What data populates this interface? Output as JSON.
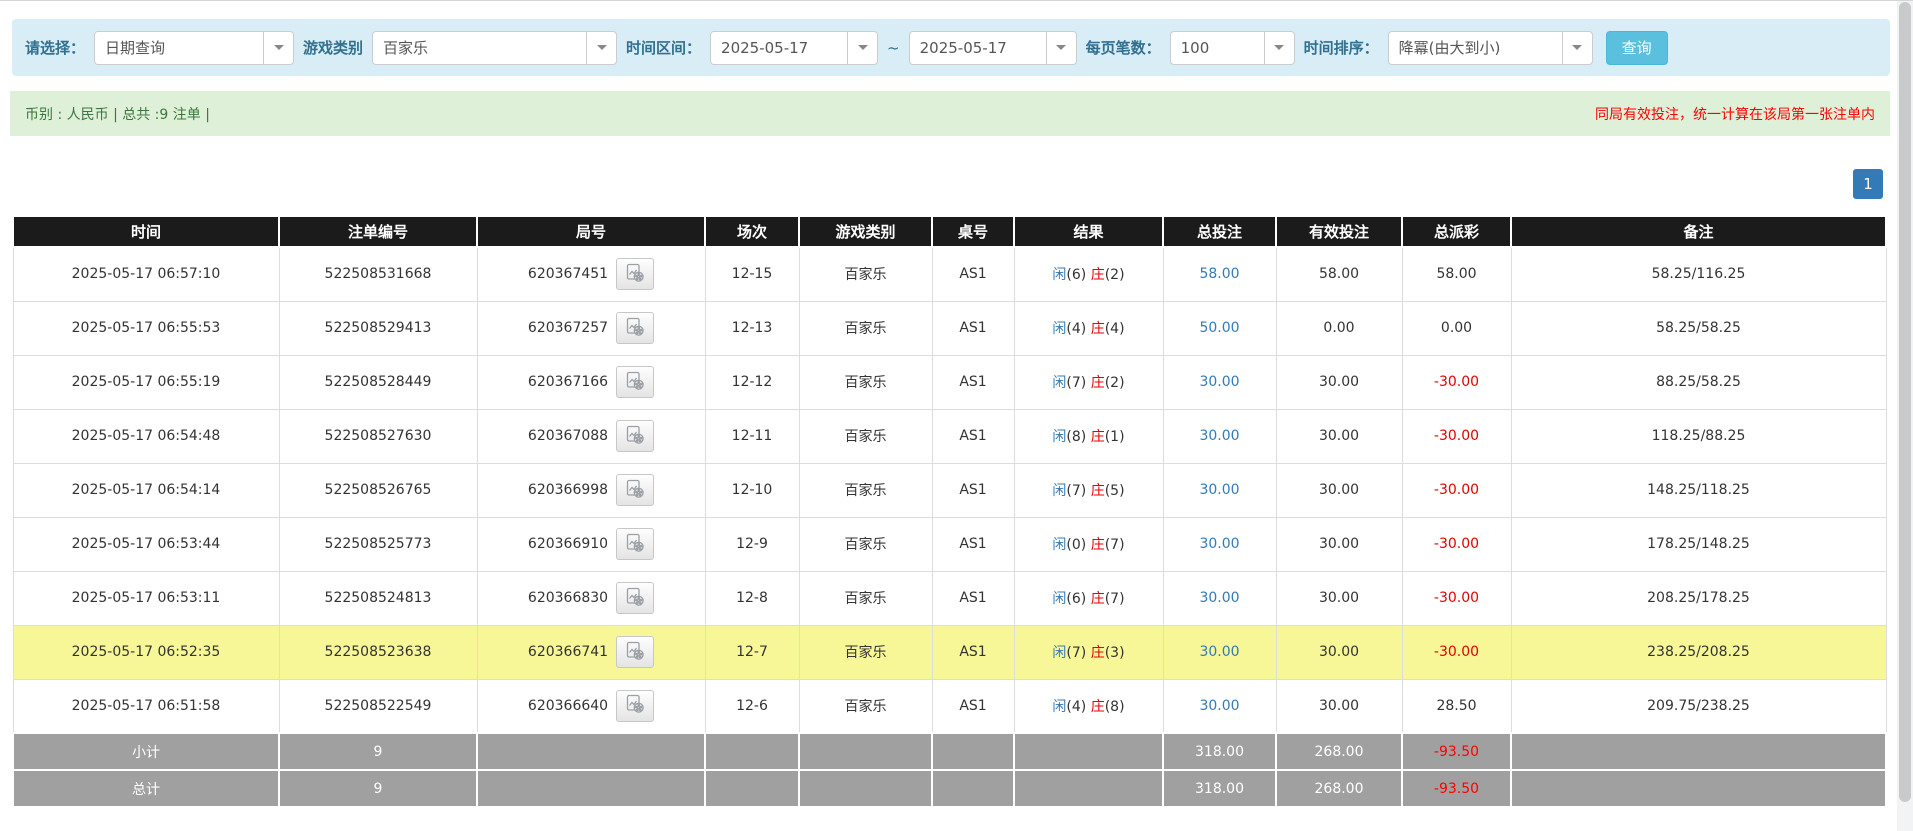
{
  "filter_bar": {
    "select_label": "请选择：",
    "select_value": "日期查询",
    "game_type_label": "游戏类别",
    "game_type_value": "百家乐",
    "time_range_label": "时间区间：",
    "date_from": "2025-05-17",
    "range_separator": "~",
    "date_to": "2025-05-17",
    "page_size_label": "每页笔数：",
    "page_size_value": "100",
    "sort_label": "时间排序：",
    "sort_value": "降冪(由大到小)",
    "search_button": "查询"
  },
  "info_bar": {
    "summary": "币别 : 人民币 | 总共 :9 注单 |",
    "notice": "同局有效投注，统一计算在该局第一张注单内"
  },
  "pagination": {
    "current_page": "1"
  },
  "table": {
    "headers": [
      "时间",
      "注单编号",
      "局号",
      "场次",
      "游戏类别",
      "桌号",
      "结果",
      "总投注",
      "有效投注",
      "总派彩",
      "备注"
    ],
    "rows": [
      {
        "time": "2025-05-17 06:57:10",
        "bet_id": "522508531668",
        "round_id": "620367451",
        "session": "12-15",
        "game": "百家乐",
        "table_no": "AS1",
        "player_label": "闲",
        "player_score": "(6)",
        "banker_label": "庄",
        "banker_score": "(2)",
        "total_bet": "58.00",
        "valid_bet": "58.00",
        "payout": "58.00",
        "remark": "58.25/116.25",
        "highlight": false
      },
      {
        "time": "2025-05-17 06:55:53",
        "bet_id": "522508529413",
        "round_id": "620367257",
        "session": "12-13",
        "game": "百家乐",
        "table_no": "AS1",
        "player_label": "闲",
        "player_score": "(4)",
        "banker_label": "庄",
        "banker_score": "(4)",
        "total_bet": "50.00",
        "valid_bet": "0.00",
        "payout": "0.00",
        "remark": "58.25/58.25",
        "highlight": false
      },
      {
        "time": "2025-05-17 06:55:19",
        "bet_id": "522508528449",
        "round_id": "620367166",
        "session": "12-12",
        "game": "百家乐",
        "table_no": "AS1",
        "player_label": "闲",
        "player_score": "(7)",
        "banker_label": "庄",
        "banker_score": "(2)",
        "total_bet": "30.00",
        "valid_bet": "30.00",
        "payout": "-30.00",
        "remark": "88.25/58.25",
        "highlight": false
      },
      {
        "time": "2025-05-17 06:54:48",
        "bet_id": "522508527630",
        "round_id": "620367088",
        "session": "12-11",
        "game": "百家乐",
        "table_no": "AS1",
        "player_label": "闲",
        "player_score": "(8)",
        "banker_label": "庄",
        "banker_score": "(1)",
        "total_bet": "30.00",
        "valid_bet": "30.00",
        "payout": "-30.00",
        "remark": "118.25/88.25",
        "highlight": false
      },
      {
        "time": "2025-05-17 06:54:14",
        "bet_id": "522508526765",
        "round_id": "620366998",
        "session": "12-10",
        "game": "百家乐",
        "table_no": "AS1",
        "player_label": "闲",
        "player_score": "(7)",
        "banker_label": "庄",
        "banker_score": "(5)",
        "total_bet": "30.00",
        "valid_bet": "30.00",
        "payout": "-30.00",
        "remark": "148.25/118.25",
        "highlight": false
      },
      {
        "time": "2025-05-17 06:53:44",
        "bet_id": "522508525773",
        "round_id": "620366910",
        "session": "12-9",
        "game": "百家乐",
        "table_no": "AS1",
        "player_label": "闲",
        "player_score": "(0)",
        "banker_label": "庄",
        "banker_score": "(7)",
        "total_bet": "30.00",
        "valid_bet": "30.00",
        "payout": "-30.00",
        "remark": "178.25/148.25",
        "highlight": false
      },
      {
        "time": "2025-05-17 06:53:11",
        "bet_id": "522508524813",
        "round_id": "620366830",
        "session": "12-8",
        "game": "百家乐",
        "table_no": "AS1",
        "player_label": "闲",
        "player_score": "(6)",
        "banker_label": "庄",
        "banker_score": "(7)",
        "total_bet": "30.00",
        "valid_bet": "30.00",
        "payout": "-30.00",
        "remark": "208.25/178.25",
        "highlight": false
      },
      {
        "time": "2025-05-17 06:52:35",
        "bet_id": "522508523638",
        "round_id": "620366741",
        "session": "12-7",
        "game": "百家乐",
        "table_no": "AS1",
        "player_label": "闲",
        "player_score": "(7)",
        "banker_label": "庄",
        "banker_score": "(3)",
        "total_bet": "30.00",
        "valid_bet": "30.00",
        "payout": "-30.00",
        "remark": "238.25/208.25",
        "highlight": true
      },
      {
        "time": "2025-05-17 06:51:58",
        "bet_id": "522508522549",
        "round_id": "620366640",
        "session": "12-6",
        "game": "百家乐",
        "table_no": "AS1",
        "player_label": "闲",
        "player_score": "(4)",
        "banker_label": "庄",
        "banker_score": "(8)",
        "total_bet": "30.00",
        "valid_bet": "30.00",
        "payout": "28.50",
        "remark": "209.75/238.25",
        "highlight": false
      }
    ],
    "subtotal": {
      "label": "小计",
      "count": "9",
      "total_bet": "318.00",
      "valid_bet": "268.00",
      "payout": "-93.50"
    },
    "total": {
      "label": "总计",
      "count": "9",
      "total_bet": "318.00",
      "valid_bet": "268.00",
      "payout": "-93.50"
    }
  },
  "colors": {
    "filter_bar_bg": "#d9edf7",
    "filter_label_blue": "#31708f",
    "info_bar_bg": "#dff0d8",
    "info_text_green": "#3c763d",
    "notice_red": "#ff0000",
    "search_button_blue": "#5bc0de",
    "pagination_blue": "#337ab7",
    "link_blue": "#337ab7",
    "banker_red": "#e60000",
    "negative_red": "#e60000",
    "highlight_yellow": "#f7f798",
    "header_bg_black": "#1b1b1b",
    "summary_row_grey": "#a0a0a0"
  }
}
